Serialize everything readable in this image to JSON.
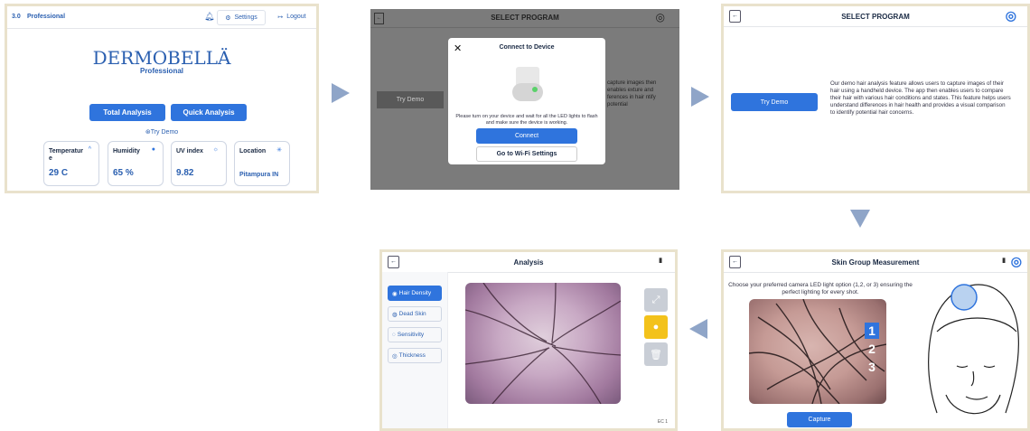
{
  "panel1": {
    "version": "3.0",
    "edition": "Professional",
    "settings_label": "Settings",
    "logout_label": "Logout",
    "brand": "DERMOBELLÄ",
    "brand_sub": "Professional",
    "total_analysis": "Total Analysis",
    "quick_analysis": "Quick Analysis",
    "try_demo": "Try Demo",
    "cards": [
      {
        "label": "Temperatur e",
        "value": "29 C"
      },
      {
        "label": "Humidity",
        "value": "65 %"
      },
      {
        "label": "UV index",
        "value": "9.82"
      },
      {
        "label": "Location",
        "value": "Pitampura IN"
      }
    ]
  },
  "panel2": {
    "title": "SELECT PROGRAM",
    "bg_button": "Try Demo",
    "bg_text": "capture images then enables exture and ferences in hair ntify potential",
    "modal_title": "Connect to Device",
    "modal_text": "Please turn on your device and wait for all the LED lights to flash and make sure the device is working.",
    "connect": "Connect",
    "wifi": "Go to Wi-Fi Settings"
  },
  "panel3": {
    "title": "SELECT PROGRAM",
    "try_demo": "Try Demo",
    "description": "Our demo hair analysis feature allows users to capture images of their hair using a handheld device. The app then enables users to compare their hair with various hair conditions and states. This feature helps users understand differences in hair health and provides a visual comparison to identify potential hair concerns."
  },
  "panel4": {
    "title": "Skin Group Measurement",
    "instruction": "Choose your preferred camera LED light option (1,2, or 3) ensuring the perfect lighting for every shot.",
    "options": [
      "1",
      "2",
      "3"
    ],
    "capture": "Capture"
  },
  "panel5": {
    "title": "Analysis",
    "menu": [
      "Hair Density",
      "Dead Skin",
      "Sensitivity",
      "Thickness"
    ],
    "footer": "EC 1"
  },
  "colors": {
    "accent": "#2f74dd",
    "border": "#e9e2cc",
    "arrow": "#8fa5c8"
  }
}
